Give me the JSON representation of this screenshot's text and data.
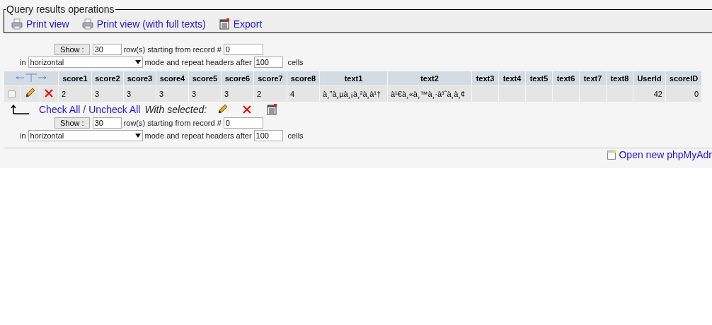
{
  "operations": {
    "title": "Query results operations",
    "links": [
      {
        "label": "Print view",
        "kind": "print"
      },
      {
        "label": "Print view (with full texts)",
        "kind": "print"
      },
      {
        "label": "Export",
        "kind": "export"
      }
    ]
  },
  "navigation_top": {
    "button": "Show :",
    "rows": "30",
    "rows_label": "row(s) starting from record #",
    "start": "0",
    "in_label": "in",
    "mode": "horizontal",
    "mode_label": "mode and repeat headers after",
    "repeat": "100",
    "cells_label": "cells"
  },
  "table": {
    "columns": [
      {
        "label": "score1",
        "kind": "text"
      },
      {
        "label": "score2",
        "kind": "text"
      },
      {
        "label": "score3",
        "kind": "text"
      },
      {
        "label": "score4",
        "kind": "text"
      },
      {
        "label": "score5",
        "kind": "text"
      },
      {
        "label": "score6",
        "kind": "text"
      },
      {
        "label": "score7",
        "kind": "text"
      },
      {
        "label": "score8",
        "kind": "text"
      },
      {
        "label": "text1",
        "kind": "text"
      },
      {
        "label": "text2",
        "kind": "text"
      },
      {
        "label": "text3",
        "kind": "text"
      },
      {
        "label": "text4",
        "kind": "text"
      },
      {
        "label": "text5",
        "kind": "text"
      },
      {
        "label": "text6",
        "kind": "text"
      },
      {
        "label": "text7",
        "kind": "text"
      },
      {
        "label": "text8",
        "kind": "text"
      },
      {
        "label": "UserId",
        "kind": "number"
      },
      {
        "label": "scoreID",
        "kind": "number"
      }
    ],
    "rows": [
      {
        "checked": false,
        "cells": [
          "2",
          "3",
          "3",
          "3",
          "3",
          "3",
          "2",
          "4",
          "à¸”à¸µà¸¡à¸²à¸à¹†",
          "à¹€à¸«à¸™à¸·à¹ˆà¸­à¸¢",
          "",
          "",
          "",
          "",
          "",
          "",
          "42",
          "0"
        ]
      }
    ]
  },
  "selected_actions": {
    "check_all": "Check All",
    "separator": "/",
    "uncheck_all": "Uncheck All",
    "label": "With selected:"
  },
  "navigation_bottom": {
    "button": "Show :",
    "rows": "30",
    "rows_label": "row(s) starting from record #",
    "start": "0",
    "in_label": "in",
    "mode": "horizontal",
    "mode_label": "mode and repeat headers after",
    "repeat": "100",
    "cells_label": "cells"
  },
  "footer": {
    "link": "Open new phpMyAdr"
  }
}
